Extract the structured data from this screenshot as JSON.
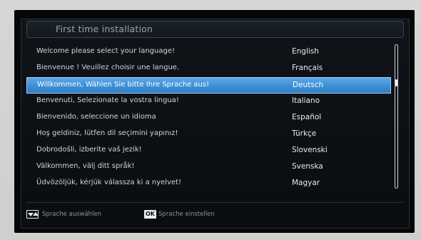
{
  "window": {
    "title": "First time installation"
  },
  "language_list": {
    "selected_index": 2,
    "items": [
      {
        "message": "Welcome please select your language!",
        "language": "English"
      },
      {
        "message": "Bienvenue ! Veuillez choisir une langue.",
        "language": "Français"
      },
      {
        "message": "Willkommen, Wählen Sie bitte Ihre Sprache aus!",
        "language": "Deutsch"
      },
      {
        "message": "Benvenuti, Selezionate la vostra lingua!",
        "language": "Italiano"
      },
      {
        "message": "Bienvenido, seleccione un idioma",
        "language": "Español"
      },
      {
        "message": "Hoş geldiniz, lütfen dil seçimini yapınız!",
        "language": "Türkçe"
      },
      {
        "message": "Dobrodošli, izberite vaš jezik!",
        "language": "Slovenski"
      },
      {
        "message": "Välkommen, välj ditt språk!",
        "language": "Svenska"
      },
      {
        "message": "Üdvözöljük, kérjük válassza ki a nyelvet!",
        "language": "Magyar"
      }
    ]
  },
  "footer": {
    "select_hint": "Sprache auswählen",
    "ok_key_label": "OK",
    "confirm_hint": "Sprache einstellen"
  },
  "colors": {
    "highlight": "#3e8fd6",
    "panel_background": "#0c1013",
    "text": "#cfd6dc"
  },
  "icons": {
    "navigate": "up-down-arrows-icon",
    "confirm": "ok-key-icon"
  }
}
